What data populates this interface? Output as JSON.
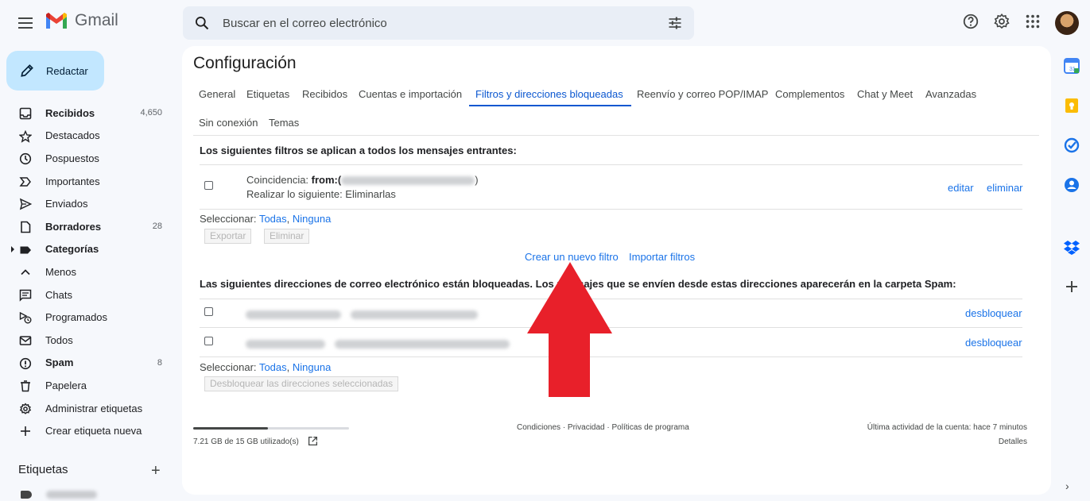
{
  "app": {
    "name": "Gmail",
    "brand_colors": {
      "red": "#ea4335",
      "blue": "#4285f4",
      "green": "#34a853",
      "yellow": "#fbbc04"
    }
  },
  "search": {
    "placeholder": "Buscar en el correo electrónico"
  },
  "header_icons": [
    "help-icon",
    "gear-icon",
    "apps-icon"
  ],
  "compose": {
    "label": "Redactar"
  },
  "nav": {
    "items": [
      {
        "label": "Recibidos",
        "count": "4,650",
        "icon": "inbox-icon",
        "bold": true
      },
      {
        "label": "Destacados",
        "count": "",
        "icon": "star-icon",
        "bold": false
      },
      {
        "label": "Pospuestos",
        "count": "",
        "icon": "clock-icon",
        "bold": false
      },
      {
        "label": "Importantes",
        "count": "",
        "icon": "important-icon",
        "bold": false
      },
      {
        "label": "Enviados",
        "count": "",
        "icon": "send-icon",
        "bold": false
      },
      {
        "label": "Borradores",
        "count": "28",
        "icon": "draft-icon",
        "bold": true
      },
      {
        "label": "Categorías",
        "count": "",
        "icon": "label-icon",
        "bold": true
      },
      {
        "label": "Menos",
        "count": "",
        "icon": "chevron-up-icon",
        "bold": false
      },
      {
        "label": "Chats",
        "count": "",
        "icon": "chat-icon",
        "bold": false
      },
      {
        "label": "Programados",
        "count": "",
        "icon": "scheduled-icon",
        "bold": false
      },
      {
        "label": "Todos",
        "count": "",
        "icon": "mail-icon",
        "bold": false
      },
      {
        "label": "Spam",
        "count": "8",
        "icon": "spam-icon",
        "bold": true
      },
      {
        "label": "Papelera",
        "count": "",
        "icon": "trash-icon",
        "bold": false
      },
      {
        "label": "Administrar etiquetas",
        "count": "",
        "icon": "gear-icon",
        "bold": false
      },
      {
        "label": "Crear etiqueta nueva",
        "count": "",
        "icon": "plus-icon",
        "bold": false
      }
    ],
    "labels_heading": "Etiquetas"
  },
  "settings": {
    "title": "Configuración",
    "tabs": [
      {
        "label": "General"
      },
      {
        "label": "Etiquetas"
      },
      {
        "label": "Recibidos"
      },
      {
        "label": "Cuentas e importación"
      },
      {
        "label": "Filtros y direcciones bloqueadas",
        "active": true
      },
      {
        "label": "Reenvío y correo POP/IMAP"
      },
      {
        "label": "Complementos"
      },
      {
        "label": "Chat y Meet"
      },
      {
        "label": "Avanzadas"
      },
      {
        "label": "Sin conexión"
      },
      {
        "label": "Temas"
      }
    ],
    "filters": {
      "heading": "Los siguientes filtros se aplican a todos los mensajes entrantes:",
      "items": [
        {
          "match_prefix": "Coincidencia: ",
          "match_bold": "from:(",
          "match_suffix": ")",
          "action": "Realizar lo siguiente: Eliminarlas"
        }
      ],
      "edit_label": "editar",
      "delete_label": "eliminar",
      "select_label": "Seleccionar:",
      "select_all": "Todas",
      "select_comma": ",",
      "select_none": "Ninguna",
      "export_button": "Exportar",
      "delete_button": "Eliminar",
      "create_filter": "Crear un nuevo filtro",
      "import_filters": "Importar filtros"
    },
    "blocked": {
      "heading": "Las siguientes direcciones de correo electrónico están bloqueadas. Los mensajes que se envíen desde estas direcciones aparecerán en la carpeta Spam:",
      "unblock_label": "desbloquear",
      "count": 2,
      "select_label": "Seleccionar:",
      "select_all": "Todas",
      "select_comma": ",",
      "select_none": "Ninguna",
      "unblock_selected_button": "Desbloquear las direcciones seleccionadas"
    }
  },
  "footer": {
    "storage_text": "7.21 GB de 15 GB utilizado(s)",
    "storage_used_fraction": 0.48,
    "links": "Condiciones · Privacidad · Políticas de programa",
    "activity": "Última actividad de la cuenta: hace 7 minutos",
    "details": "Detalles"
  },
  "overlay": {
    "arrow_color": "#e8202a"
  },
  "right_rail": [
    "calendar-icon",
    "keep-icon",
    "tasks-icon",
    "contacts-icon",
    "dropbox-icon",
    "add-addon-icon"
  ]
}
